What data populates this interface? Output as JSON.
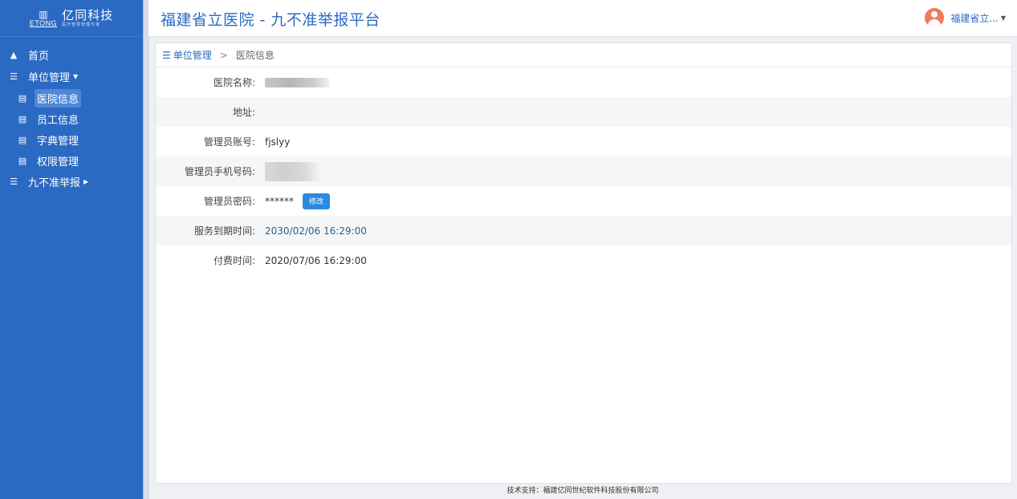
{
  "app": {
    "logo_cn": "亿同科技",
    "logo_en": "ETONG",
    "logo_sub": "医疗智慧管理专家",
    "title": "福建省立医院 - 九不准举报平台",
    "user_name": "福建省立..."
  },
  "sidebar": {
    "items": [
      {
        "label": "首页",
        "icon": "home-icon"
      },
      {
        "label": "单位管理",
        "icon": "list-icon",
        "expanded": true
      },
      {
        "label": "医院信息",
        "icon": "card-icon",
        "active": true
      },
      {
        "label": "员工信息",
        "icon": "card-icon"
      },
      {
        "label": "字典管理",
        "icon": "card-icon"
      },
      {
        "label": "权限管理",
        "icon": "card-icon"
      },
      {
        "label": "九不准举报",
        "icon": "list-icon",
        "expanded": false
      }
    ]
  },
  "breadcrumb": {
    "parent": "单位管理",
    "separator": ">",
    "current": "医院信息"
  },
  "fields": [
    {
      "label": "医院名称:",
      "value": ""
    },
    {
      "label": "地址:",
      "value": ""
    },
    {
      "label": "管理员账号:",
      "value": "fjslyy"
    },
    {
      "label": "管理员手机号码:",
      "value": ""
    },
    {
      "label": "管理员密码:",
      "value": "******",
      "button": "修改"
    },
    {
      "label": "服务到期时间:",
      "value": "2030/02/06 16:29:00"
    },
    {
      "label": "付费时间:",
      "value": "2020/07/06 16:29:00"
    }
  ],
  "footer": "技术支持：福建亿同世纪软件科技股份有限公司",
  "colors": {
    "sidebar": "#2b6ac3",
    "accent": "#2b6ac3",
    "button": "#2b8ae0",
    "avatar": "#f07b5c"
  }
}
